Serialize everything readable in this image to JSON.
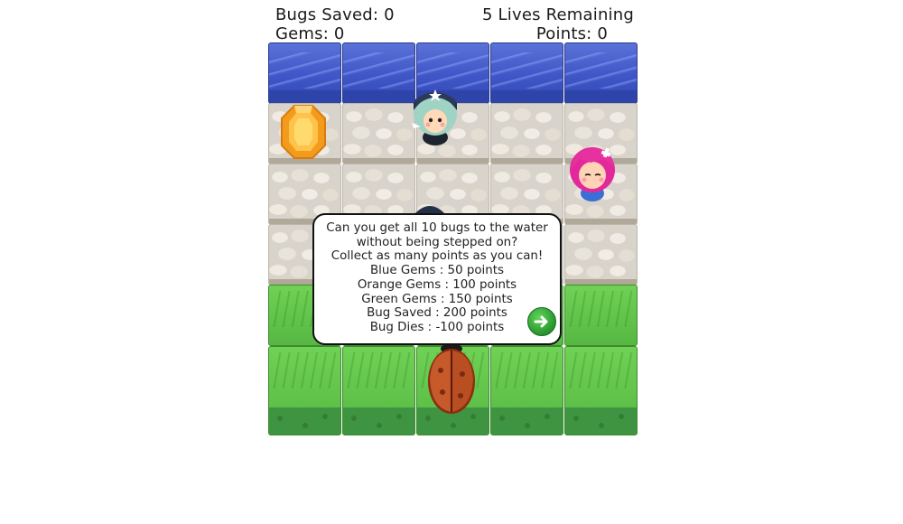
{
  "hud": {
    "bugs_saved": "Bugs Saved: 0",
    "gems": "Gems: 0",
    "lives": "5 Lives Remaining",
    "points": "Points: 0"
  },
  "board": {
    "columns": 5,
    "rows": [
      "water",
      "stone",
      "stone",
      "stone",
      "grass",
      "grass"
    ],
    "items": {
      "gem": {
        "type": "orange-gem",
        "row": 1,
        "col": 0
      },
      "bug": {
        "type": "bug",
        "row": 5,
        "col": 2
      },
      "enemies": [
        {
          "type": "enemy-blue-cap",
          "row": 1,
          "col": 2
        },
        {
          "type": "enemy-pink-hair",
          "row": 2,
          "col": 4
        },
        {
          "type": "enemy-blue-cap-partial",
          "row": 3,
          "col": 2
        }
      ]
    }
  },
  "dialog": {
    "lines": [
      "Can you get all 10 bugs to the water",
      "without being stepped on?",
      "Collect as many points as you can!",
      "Blue Gems : 50 points",
      "Orange Gems : 100 points",
      "Green Gems : 150 points",
      "Bug Saved : 200 points",
      "Bug Dies : -100 points"
    ],
    "next_icon": "arrow-right-icon"
  },
  "colors": {
    "water": "#3f56c7",
    "grass": "#5fc24a",
    "stone": "#d8d3cb",
    "next_button": "#2e9e32",
    "gem": "#f5a623"
  }
}
